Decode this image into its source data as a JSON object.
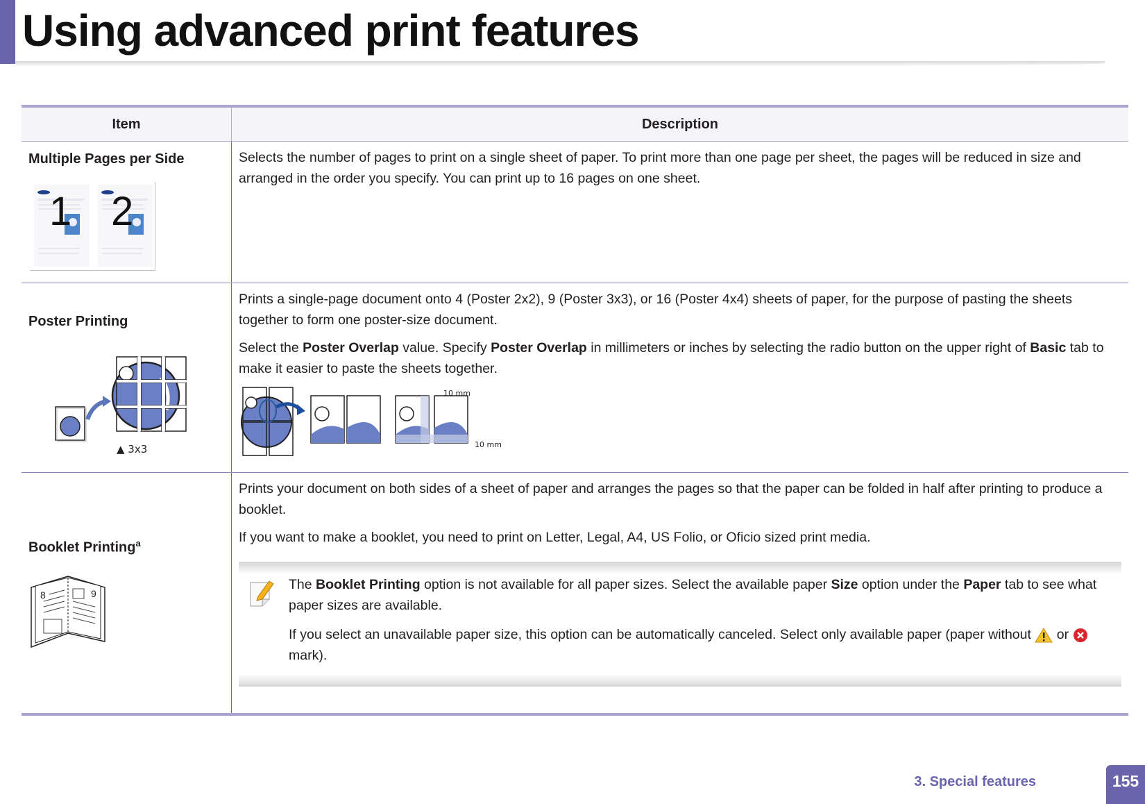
{
  "header": {
    "title": "Using advanced print features"
  },
  "table": {
    "headers": {
      "item": "Item",
      "description": "Description"
    },
    "rows": [
      {
        "item": "Multiple Pages per Side",
        "image": "multiple-pages-illustration",
        "page_labels": [
          "1",
          "2"
        ],
        "paragraphs": [
          "Selects the number of pages to print on a single sheet of paper. To print more than one page per sheet, the pages will be reduced in size and arranged in the order you specify. You can print up to 16 pages on one sheet."
        ]
      },
      {
        "item": "Poster Printing",
        "image": "poster-printing-illustration",
        "grid_caption": "▲ 3x3",
        "p1": "Prints a single-page document onto 4 (Poster 2x2), 9 (Poster 3x3), or 16 (Poster 4x4) sheets of paper, for the purpose of pasting the sheets together to form one poster-size document.",
        "p2": {
          "t1": "Select the ",
          "b1": "Poster Overlap",
          "t2": " value. Specify ",
          "b2": "Poster Overlap",
          "t3": " in millimeters or inches by selecting the radio button on the upper right of ",
          "b3": "Basic",
          "t4": " tab to make it easier to paste the sheets together."
        },
        "overlap_labels": {
          "top": "10 mm",
          "side": "10 mm"
        }
      },
      {
        "item": "Booklet Printing",
        "footnote": "a",
        "image": "booklet-illustration",
        "booklet_pages": [
          "8",
          "9"
        ],
        "p1": "Prints your document on both sides of a sheet of paper and arranges the pages so that the paper can be folded in half after printing to produce a booklet.",
        "p2": "If you want to make a booklet, you need to print on Letter, Legal, A4, US Folio, or Oficio sized print media.",
        "note": {
          "n1": {
            "t1": "The ",
            "b1": "Booklet Printing",
            "t2": " option is not available for all paper sizes. Select the available paper ",
            "b2": "Size",
            "t3": " option under the ",
            "b3": "Paper",
            "t4": " tab to see what paper sizes are available."
          },
          "n2": {
            "t1": "If you select an unavailable paper size, this option can be automatically canceled. Select only available paper (paper without ",
            "t2": " or ",
            "t3": " mark)."
          }
        }
      }
    ]
  },
  "footer": {
    "chapter": "3.  Special features",
    "page": "155"
  },
  "colors": {
    "accent": "#6a64ac",
    "header_bg": "#f4f4f9",
    "illustration_blue": "#6b7fc4"
  }
}
